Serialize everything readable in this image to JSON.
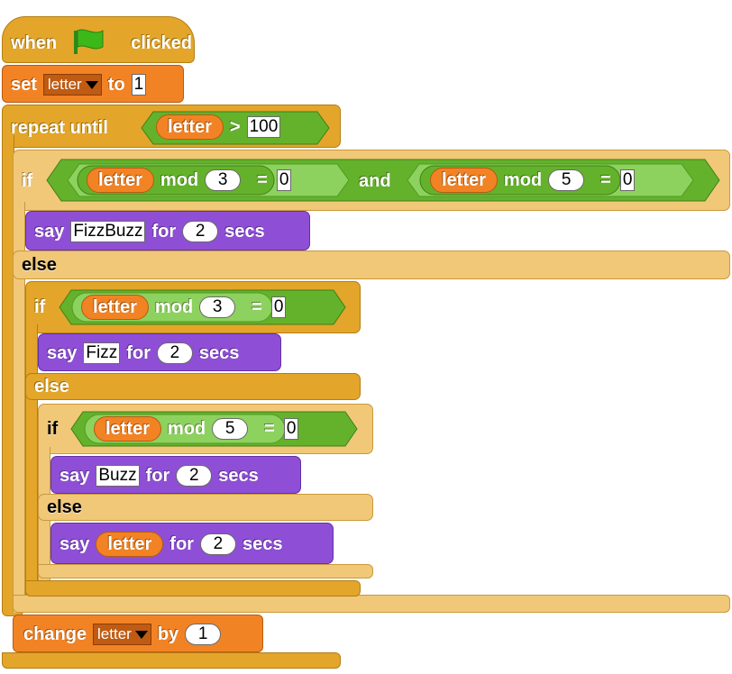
{
  "colors": {
    "control": "#e3a62a",
    "control_light": "#f0c878",
    "variables": "#f28325",
    "operators": "#64b22b",
    "operators_light": "#8dd15e",
    "looks": "#8e4fd6",
    "flag": "#3cb81a"
  },
  "hat": {
    "when": "when",
    "clicked": "clicked",
    "icon": "green-flag-icon"
  },
  "set_block": {
    "set": "set",
    "var": "letter",
    "to": "to",
    "value": "1"
  },
  "repeat_block": {
    "repeat_until": "repeat until",
    "var": "letter",
    "op": ">",
    "value": "100"
  },
  "if1": {
    "if": "if",
    "left": {
      "var": "letter",
      "mod": "mod",
      "n": "3",
      "eq": "=",
      "r": "0"
    },
    "and": "and",
    "right": {
      "var": "letter",
      "mod": "mod",
      "n": "5",
      "eq": "=",
      "r": "0"
    },
    "say": {
      "say": "say",
      "text": "FizzBuzz",
      "for": "for",
      "secs_value": "2",
      "secs": "secs"
    },
    "else": "else"
  },
  "if2": {
    "if": "if",
    "cond": {
      "var": "letter",
      "mod": "mod",
      "n": "3",
      "eq": "=",
      "r": "0"
    },
    "say": {
      "say": "say",
      "text": "Fizz",
      "for": "for",
      "secs_value": "2",
      "secs": "secs"
    },
    "else": "else"
  },
  "if3": {
    "if": "if",
    "cond": {
      "var": "letter",
      "mod": "mod",
      "n": "5",
      "eq": "=",
      "r": "0"
    },
    "say": {
      "say": "say",
      "text": "Buzz",
      "for": "for",
      "secs_value": "2",
      "secs": "secs"
    },
    "else": "else",
    "say_else": {
      "say": "say",
      "var": "letter",
      "for": "for",
      "secs_value": "2",
      "secs": "secs"
    }
  },
  "change_block": {
    "change": "change",
    "var": "letter",
    "by": "by",
    "value": "1"
  }
}
